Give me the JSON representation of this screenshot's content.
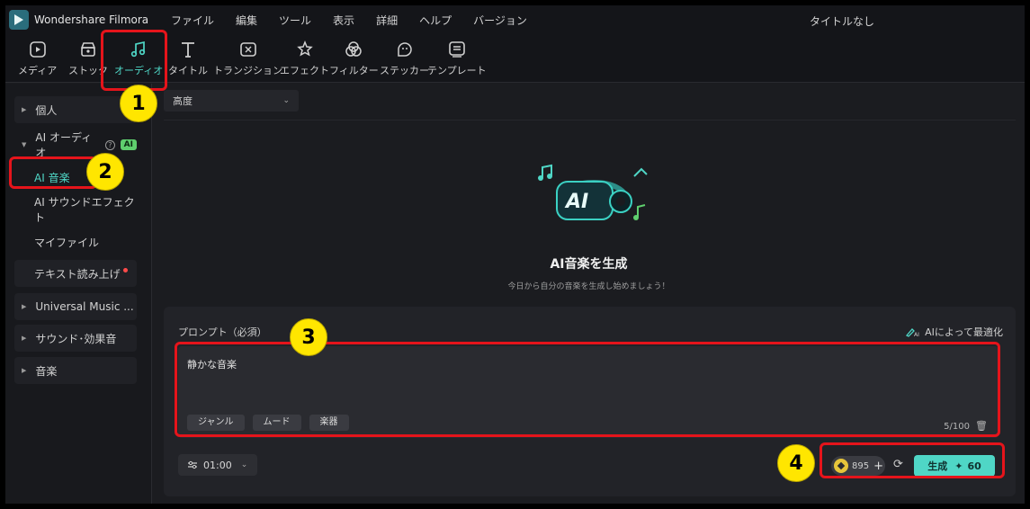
{
  "app": {
    "name": "Wondershare Filmora",
    "document_title": "タイトルなし"
  },
  "menu": [
    "ファイル",
    "編集",
    "ツール",
    "表示",
    "詳細",
    "ヘルプ",
    "バージョン"
  ],
  "toolbar": [
    {
      "label": "メディア",
      "icon": "media-icon"
    },
    {
      "label": "ストック",
      "icon": "stock-icon"
    },
    {
      "label": "オーディオ",
      "icon": "music-note-icon",
      "active": true
    },
    {
      "label": "タイトル",
      "icon": "text-icon"
    },
    {
      "label": "トランジション",
      "icon": "transition-icon"
    },
    {
      "label": "エフェクト",
      "icon": "effects-icon"
    },
    {
      "label": "フィルター",
      "icon": "filter-icon"
    },
    {
      "label": "ステッカー",
      "icon": "sticker-icon"
    },
    {
      "label": "テンプレート",
      "icon": "template-icon"
    }
  ],
  "sidebar": {
    "personal": "個人",
    "ai_audio": "AI オーディオ",
    "ai_badge": "AI",
    "ai_music": "AI 音楽",
    "ai_sfx": "AI サウンドエフェクト",
    "my_files": "マイファイル",
    "tts": "テキスト読み上げ",
    "universal": "Universal Music ...",
    "sound_effects": "サウンド･効果音",
    "music": "音楽"
  },
  "main": {
    "dropdown": "高度",
    "hero_title": "AI音楽を生成",
    "hero_subtitle": "今日から自分の音楽を生成し始めましょう！",
    "prompt_label": "プロンプト（必須）",
    "optimize_label": "AIによって最適化",
    "prompt_text": "静かな音楽",
    "chips": [
      "ジャンル",
      "ムード",
      "楽器"
    ],
    "char_count": "5/100",
    "duration": "01:00",
    "credits": "895",
    "generate_label": "生成",
    "generate_cost": "60"
  },
  "annotations": [
    "1",
    "2",
    "3",
    "4"
  ],
  "colors": {
    "accent": "#4fd6c6",
    "highlight": "#e5141b",
    "badge": "#ffe600"
  }
}
